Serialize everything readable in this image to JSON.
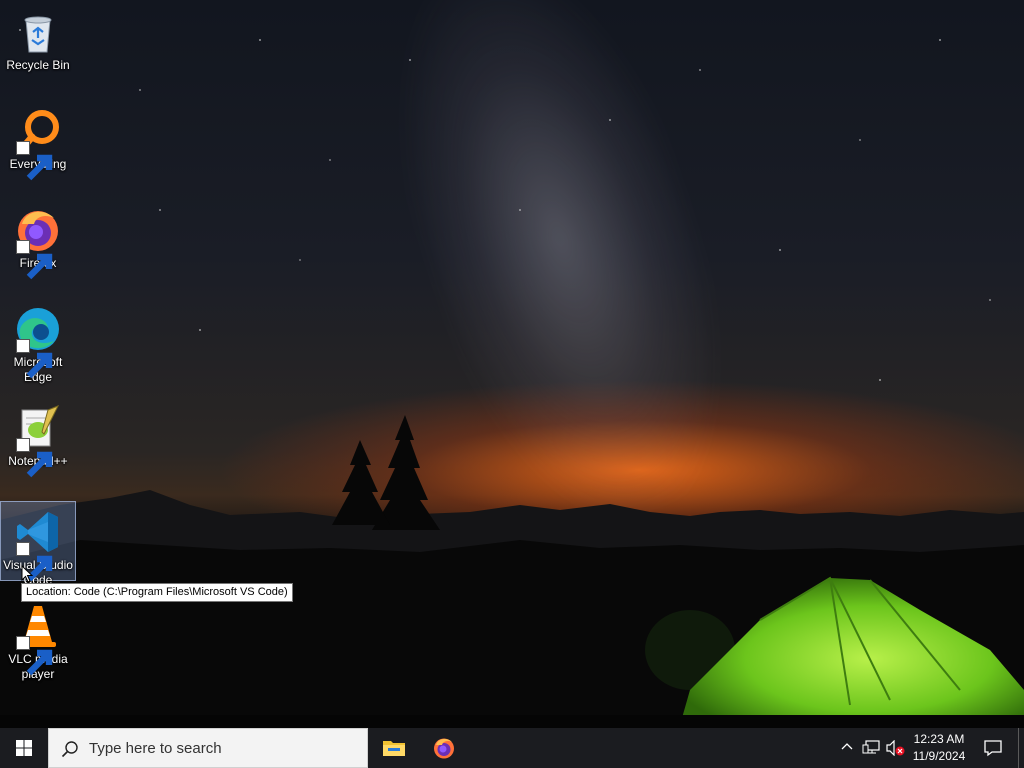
{
  "desktop": {
    "icons": [
      {
        "label": "Recycle Bin",
        "icon": "recycle-bin-icon"
      },
      {
        "label": "Everything",
        "icon": "everything-search-icon"
      },
      {
        "label": "Firefox",
        "icon": "firefox-icon"
      },
      {
        "label": "Microsoft Edge",
        "icon": "edge-icon"
      },
      {
        "label": "Notepad++",
        "icon": "notepad-plus-plus-icon"
      },
      {
        "label": "Visual Studio Code",
        "icon": "vscode-icon",
        "selected": true
      },
      {
        "label": "VLC media player",
        "icon": "vlc-icon"
      }
    ],
    "tooltip": "Location: Code (C:\\Program Files\\Microsoft VS Code)"
  },
  "taskbar": {
    "search_placeholder": "Type here to search",
    "pinned": [
      {
        "name": "File Explorer",
        "icon": "file-explorer-icon"
      },
      {
        "name": "Firefox",
        "icon": "firefox-icon"
      }
    ],
    "tray": {
      "time": "12:23 AM",
      "date": "11/9/2024",
      "icons": [
        "chevron-up-icon",
        "network-icon",
        "volume-muted-icon",
        "notification-icon"
      ]
    }
  },
  "colors": {
    "taskbar_bg": "#1b1c20",
    "search_bg": "#f3f3f3",
    "tent_green": "#7ed321",
    "horizon_orange": "#ff6e14"
  }
}
